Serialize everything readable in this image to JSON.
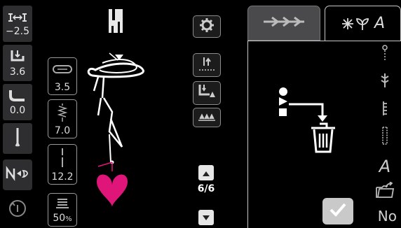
{
  "left_column": {
    "stitch_width": {
      "value": "−2.5",
      "icon": "needle-position-icon"
    },
    "stitch_length": {
      "value": "3.6",
      "icon": "foot-pressure-icon"
    },
    "thread_tension": {
      "value": "0.0",
      "icon": "presser-foot-height-icon"
    },
    "needle": {
      "icon": "needle-icon"
    },
    "mirror": {
      "icon": "mirror-stitch-icon"
    },
    "restart": {
      "icon": "restart-icon"
    }
  },
  "second_column": {
    "buttonhole_length": {
      "value": "3.5",
      "icon": "buttonhole-icon"
    },
    "stitch_density": {
      "value": "7.0",
      "icon": "zigzag-icon"
    },
    "stitch_length": {
      "value": "12.2",
      "icon": "straight-stitch-icon"
    },
    "balance": {
      "value": "50",
      "unit": "%",
      "icon": "balance-icon"
    }
  },
  "center": {
    "presser_foot": {
      "icon": "presser-foot-icon"
    },
    "settings": {
      "icon": "gear-icon"
    },
    "needle_stop": {
      "icon": "needle-stop-icon"
    },
    "foot_lift": {
      "icon": "foot-lift-icon"
    },
    "feed_dogs": {
      "icon": "feed-dogs-icon"
    },
    "page_indicator": "6/6",
    "page_up": {
      "icon": "arrow-up-icon"
    },
    "page_down": {
      "icon": "arrow-down-icon"
    }
  },
  "right_panel": {
    "tabs": [
      {
        "icon": "stitch-sequence-icon",
        "active": false
      },
      {
        "label": "A",
        "icon": "stitch-categories-icon",
        "active": true
      }
    ],
    "main_icon": "delete-stitch-trash-icon",
    "side_icons": [
      "decorative-stitch-icon",
      "utility-stitch-icon",
      "quilt-stitch-icon",
      "buttonhole-stitch-icon",
      "alphabet-icon",
      "personal-folder-icon"
    ],
    "alphabet_label": "A",
    "confirm_icon": "checkmark-icon",
    "bottom_label": "No"
  },
  "colors": {
    "accent_pink": "#e0157a",
    "panel_bg": "#2e2e30",
    "border": "#9a9a9a"
  }
}
